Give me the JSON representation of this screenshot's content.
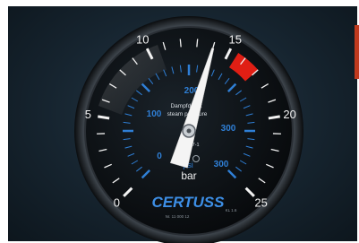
{
  "gauge": {
    "scale_bar_labels": [
      "0",
      "5",
      "10",
      "15",
      "20",
      "25"
    ],
    "scale_psi_labels": [
      "0",
      "100",
      "200",
      "300",
      "300"
    ],
    "title_line1": "Dampfdruck",
    "title_line2": "steam pressure",
    "class_mark": "cl 1.6",
    "unit_psi": "psi",
    "unit_bar": "bar",
    "model_code": "EN 837-1",
    "brand": "CERTUSS",
    "footer_left": "Nr. 11 000 12",
    "footer_right": "KL 1.6",
    "needle_reading_bar": 14,
    "red_zone_bar": [
      15.5,
      17
    ],
    "colors": {
      "face": "#0b0f13",
      "bar_scale": "#f2f2f2",
      "psi_scale": "#2f7fd6",
      "brand": "#3d8fe6",
      "red_zone": "#e01e14",
      "needle": "#f4f4f4"
    }
  }
}
